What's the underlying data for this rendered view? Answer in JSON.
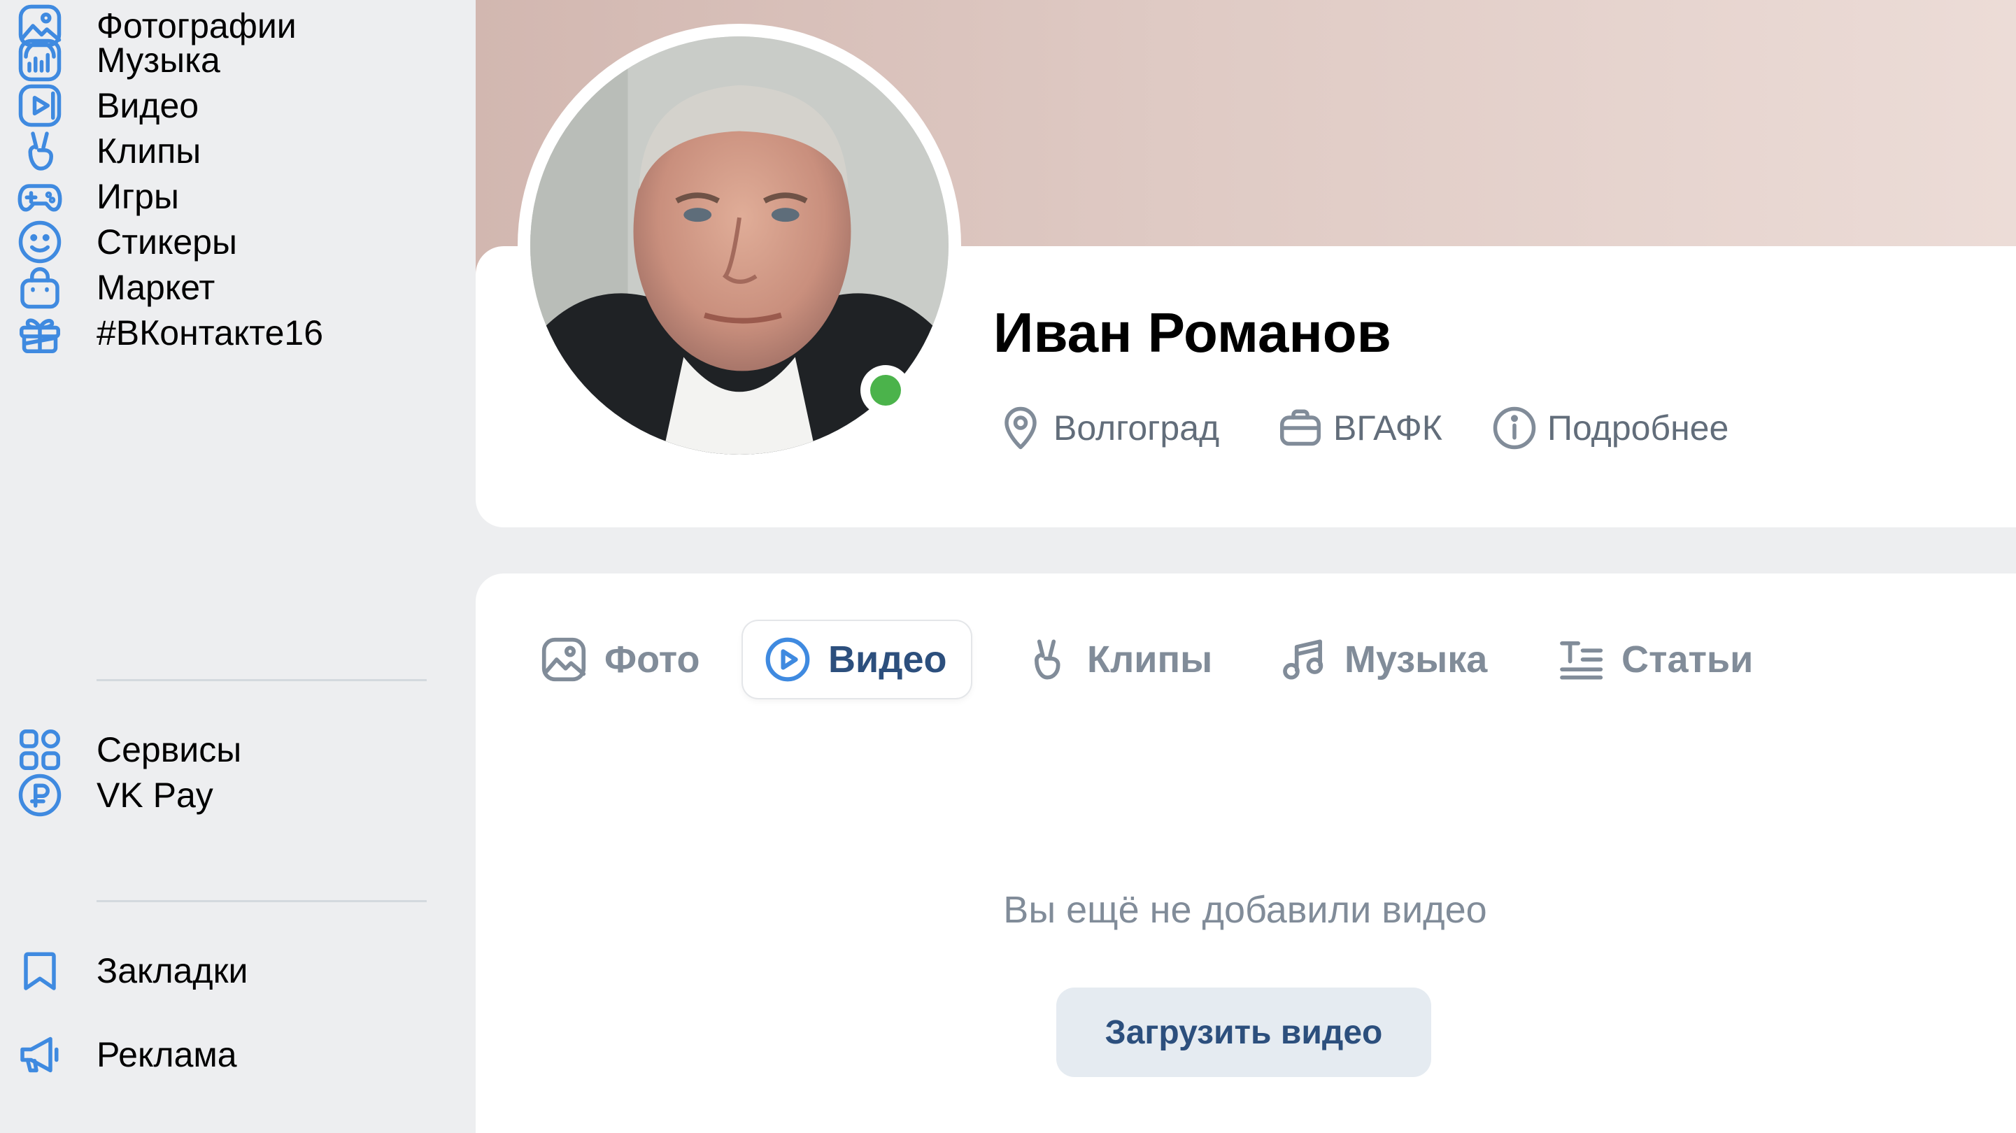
{
  "sidebar": {
    "items": [
      {
        "label": "Фотографии",
        "icon": "photo-icon"
      },
      {
        "label": "Музыка",
        "icon": "music-icon"
      },
      {
        "label": "Видео",
        "icon": "video-icon"
      },
      {
        "label": "Клипы",
        "icon": "clips-icon"
      },
      {
        "label": "Игры",
        "icon": "gamepad-icon"
      },
      {
        "label": "Стикеры",
        "icon": "smile-icon"
      },
      {
        "label": "Маркет",
        "icon": "shopping-bag-icon"
      },
      {
        "label": "#ВКонтакте16",
        "icon": "gift-icon"
      },
      {
        "label": "Сервисы",
        "icon": "services-grid-icon"
      },
      {
        "label": "VK Pay",
        "icon": "ruble-coin-icon"
      },
      {
        "label": "Закладки",
        "icon": "bookmark-icon"
      },
      {
        "label": "Реклама",
        "icon": "megaphone-icon"
      }
    ]
  },
  "profile": {
    "name": "Иван Романов",
    "online": true,
    "meta": [
      {
        "label": "Волгоград",
        "icon": "location-pin-icon"
      },
      {
        "label": "ВГАФК",
        "icon": "briefcase-icon"
      },
      {
        "label": "Подробнее",
        "icon": "info-icon"
      }
    ]
  },
  "tabs": [
    {
      "label": "Фото",
      "icon": "photo-icon",
      "active": false
    },
    {
      "label": "Видео",
      "icon": "play-circle-icon",
      "active": true
    },
    {
      "label": "Клипы",
      "icon": "clips-icon",
      "active": false
    },
    {
      "label": "Музыка",
      "icon": "music-note-icon",
      "active": false
    },
    {
      "label": "Статьи",
      "icon": "article-icon",
      "active": false
    }
  ],
  "empty_state": {
    "message": "Вы ещё не добавили видео",
    "button_label": "Загрузить видео"
  },
  "colors": {
    "icon_blue": "#3f8ae0",
    "online_green": "#4bb34b",
    "active_tab_text": "#2c4f7d",
    "muted_text": "#818c99"
  }
}
